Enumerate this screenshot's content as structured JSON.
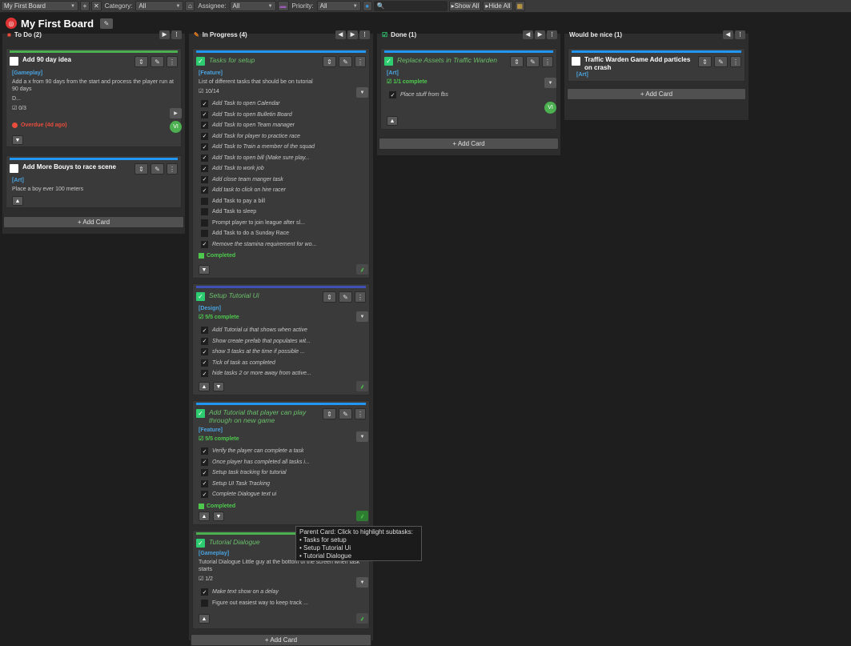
{
  "toolbar": {
    "board_select": "My First Board",
    "add": "+",
    "close": "✕",
    "category_label": "Category:",
    "category_value": "All",
    "assignee_label": "Assignee:",
    "assignee_value": "All",
    "priority_label": "Priority:",
    "priority_value": "All",
    "search_placeholder": "",
    "show_all": "Show All",
    "hide_all": "Hide All"
  },
  "board": {
    "title": "My First Board"
  },
  "columns": {
    "todo": {
      "title": "To Do  (2)",
      "add_card": "+ Add Card",
      "cards": [
        {
          "title": "Add 90 day idea",
          "category": "[Gameplay]",
          "desc": "Add a x from 90 days from the start and process the player run at 90 days",
          "desc2": "D...",
          "progress": "☑ 0/3",
          "overdue": "Overdue (4d ago)",
          "avatar": "VI"
        },
        {
          "title": "Add More Bouys to race scene",
          "category": "[Art]",
          "desc": "Place a boy ever 100 meters"
        }
      ]
    },
    "progress": {
      "title": "In Progress  (4)",
      "add_card": "+ Add Card",
      "cards": [
        {
          "title": "Tasks for setup",
          "category": "[Feature]",
          "desc": "List of different tasks that should be on tutorial",
          "progress": "☑ 10/14",
          "subtasks": [
            {
              "t": "Add Task to open Calendar",
              "d": true
            },
            {
              "t": "Add Task to open Bulletin Board",
              "d": true
            },
            {
              "t": "Add Task to open Team manager",
              "d": true
            },
            {
              "t": "Add Task for player to practice race",
              "d": true
            },
            {
              "t": "Add Task to Train a member of the squad",
              "d": true
            },
            {
              "t": "Add Task to open bill (Make sure play...",
              "d": true
            },
            {
              "t": "Add Task to work job",
              "d": true
            },
            {
              "t": "Add close team manger task",
              "d": true
            },
            {
              "t": "Add task to click on hire racer",
              "d": true
            },
            {
              "t": "Add Task to pay a bill",
              "d": false
            },
            {
              "t": "Add Task to sleep",
              "d": false
            },
            {
              "t": "Prompt player to join league after sl...",
              "d": false
            },
            {
              "t": "Add Task to do a Sunday Race",
              "d": false
            },
            {
              "t": "Remove the stamina requirement for wo...",
              "d": true
            }
          ],
          "completed": "Completed"
        },
        {
          "title": "Setup Tutorial Ui",
          "category": "[Design]",
          "progress": "5/5 complete",
          "subtasks": [
            {
              "t": "Add Tutorial ui that shows when active",
              "d": true
            },
            {
              "t": "Show create prefab that populates wit...",
              "d": true
            },
            {
              "t": "show 3 tasks at the time if possible ...",
              "d": true
            },
            {
              "t": "Tick of task as completed",
              "d": true
            },
            {
              "t": "hide tasks 2 or more away from active...",
              "d": true
            }
          ]
        },
        {
          "title": "Add Tutorial that player can play through on new game",
          "category": "[Feature]",
          "progress": "5/5 complete",
          "subtasks": [
            {
              "t": "Verify the player can complete a task",
              "d": true
            },
            {
              "t": "Once player has completed all tasks i...",
              "d": true
            },
            {
              "t": "Setup task tracking for tutorial",
              "d": true
            },
            {
              "t": "Setup UI Task Tracking",
              "d": true
            },
            {
              "t": "Complete Dialogue text ui",
              "d": true
            }
          ],
          "completed": "Completed"
        },
        {
          "title": "Tutorial Dialogue",
          "category": "[Gameplay]",
          "desc": "Tutorial Dialogue Little guy at the bottom of the screen when task starts",
          "progress": "☑ 1/2",
          "subtasks": [
            {
              "t": "Make text show on a delay",
              "d": true
            },
            {
              "t": "Figure out easiest way to keep track ...",
              "d": false
            }
          ]
        }
      ]
    },
    "done": {
      "title": "Done  (1)",
      "add_card": "+ Add Card",
      "cards": [
        {
          "title": "Replace Assets in Traffic Warden",
          "category": "[Art]",
          "progress": "1/1 complete",
          "subtasks": [
            {
              "t": "Place stuff from fbs",
              "d": true
            }
          ],
          "avatar": "VI"
        }
      ]
    },
    "nice": {
      "title": "Would be nice  (1)",
      "add_card": "+ Add Card",
      "cards": [
        {
          "title": "Traffic Warden Game Add particles on crash",
          "category": "[Art]"
        }
      ]
    }
  },
  "tooltip": {
    "title": "Parent Card: Click to highlight subtasks:",
    "items": [
      "• Tasks for setup",
      "• Setup Tutorial Ui",
      "• Tutorial Dialogue"
    ]
  },
  "colors": {
    "gameplay_bar": "#4caf50",
    "art_bar": "#2196f3",
    "feature_bar": "#2196f3",
    "design_bar": "#3f51b5",
    "overdue": "#e74c3c"
  }
}
